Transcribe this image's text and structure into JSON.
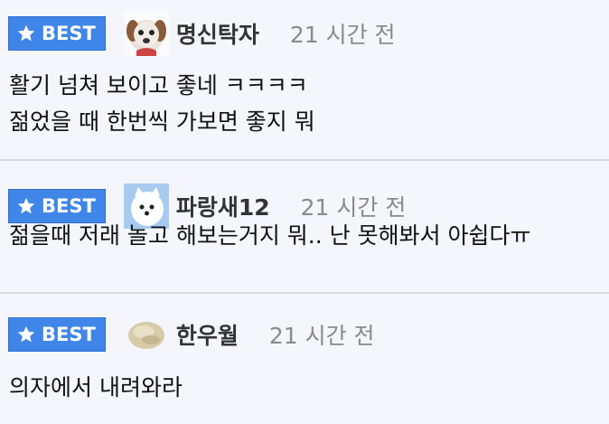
{
  "badge_label": "BEST",
  "comments": [
    {
      "nickname": "명신탁자",
      "time": "21 시간 전",
      "lines": [
        "활기 넘쳐 보이고 좋네 ㅋㅋㅋㅋ",
        "젊었을 때 한번씩 가보면 좋지 뭐"
      ]
    },
    {
      "nickname": "파랑새12",
      "time": "21 시간 전",
      "lines": [
        "젊을때 저래 놀고 해보는거지 뭐.. 난 못해봐서 아쉽다ㅠ"
      ]
    },
    {
      "nickname": "한우월",
      "time": "21 시간 전",
      "lines": [
        "의자에서 내려와라"
      ]
    }
  ],
  "colors": {
    "badge_bg": "#3f86e8",
    "page_bg": "#f4f6fc",
    "nickname": "#333333",
    "time": "#8a8a8a"
  }
}
